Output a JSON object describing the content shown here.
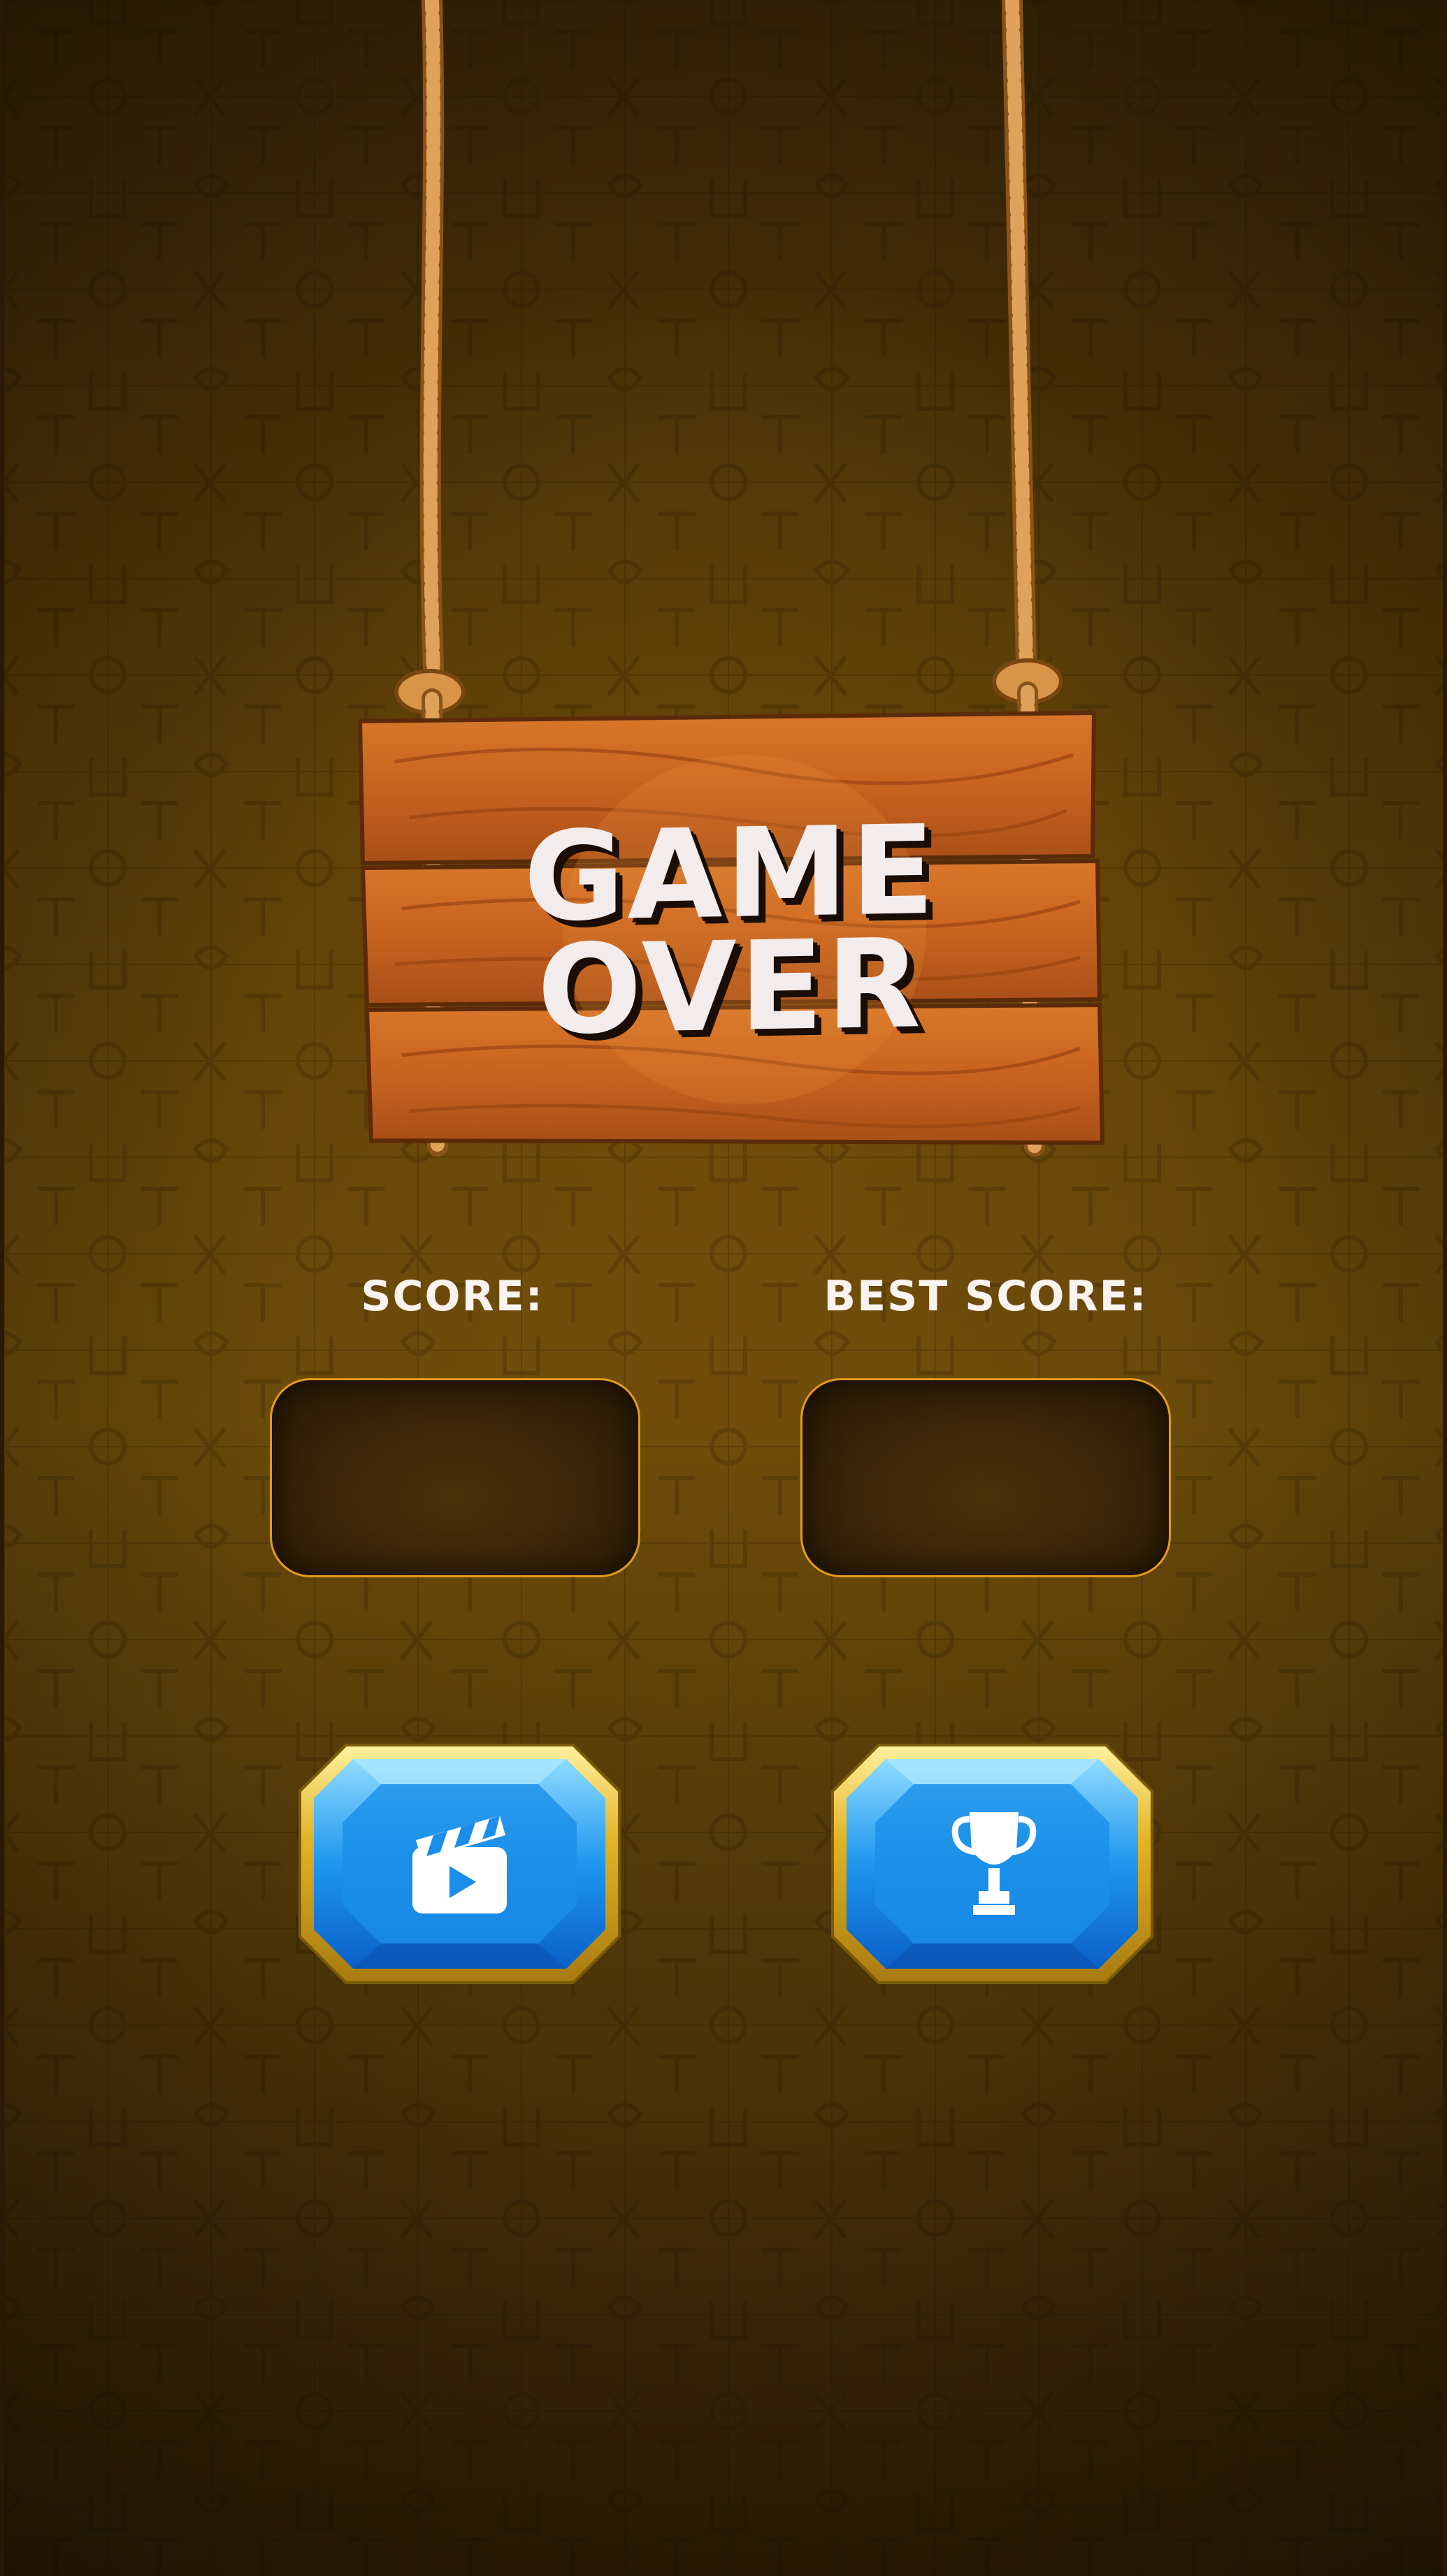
{
  "screen": {
    "title_line1": "GAME",
    "title_line2": "OVER"
  },
  "scores": {
    "score_label": "SCORE:",
    "best_label": "BEST SCORE:",
    "score_value": "",
    "best_value": ""
  },
  "buttons": {
    "left_icon": "clapperboard-icon",
    "right_icon": "trophy-icon"
  },
  "colors": {
    "background": "#5a3d08",
    "label_text": "#fbf3f0",
    "score_box_border": "#e39a1f",
    "gem_blue": "#1e96ee",
    "gem_gold": "#e2b425",
    "wood": "#c8631f"
  }
}
